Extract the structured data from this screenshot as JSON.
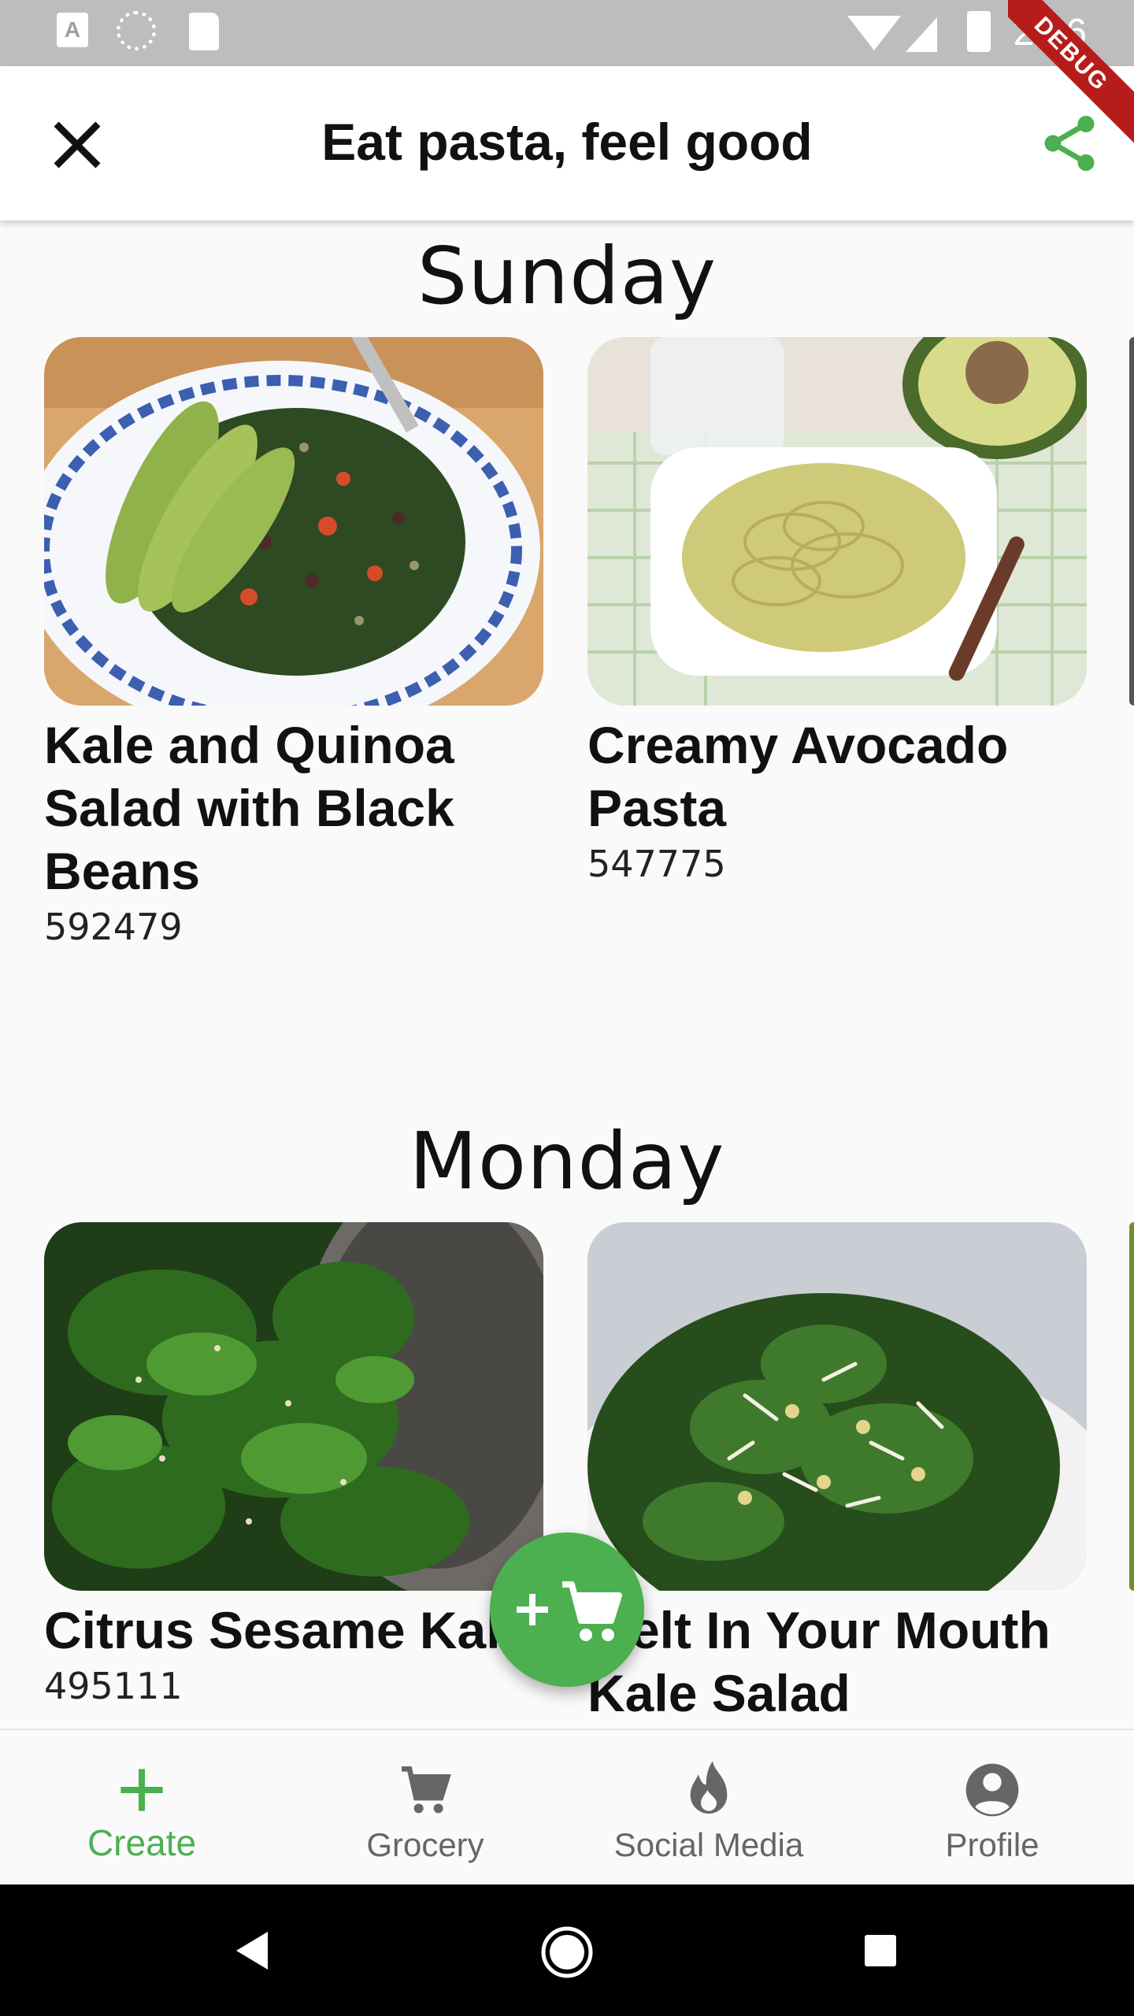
{
  "status_bar": {
    "time": "2:26",
    "debug_label": "DEBUG"
  },
  "app_bar": {
    "title": "Eat pasta, feel good"
  },
  "days": [
    {
      "name": "Sunday",
      "recipes": [
        {
          "title": "Kale and Quinoa Salad with Black Beans",
          "id": "592479"
        },
        {
          "title": "Creamy Avocado Pasta",
          "id": "547775"
        }
      ]
    },
    {
      "name": "Monday",
      "recipes": [
        {
          "title": "Citrus Sesame Kale",
          "id": "495111"
        },
        {
          "title": "Melt In Your Mouth Kale Salad",
          "id": ""
        }
      ]
    }
  ],
  "bottom_nav": [
    {
      "label": "Create",
      "icon": "plus-icon",
      "active": true
    },
    {
      "label": "Grocery",
      "icon": "cart-icon",
      "active": false
    },
    {
      "label": "Social Media",
      "icon": "flame-icon",
      "active": false
    },
    {
      "label": "Profile",
      "icon": "account-circle-icon",
      "active": false
    }
  ],
  "colors": {
    "accent": "#4caf50",
    "status_bar": "#bdbdbd",
    "debug": "#b71c1c"
  }
}
